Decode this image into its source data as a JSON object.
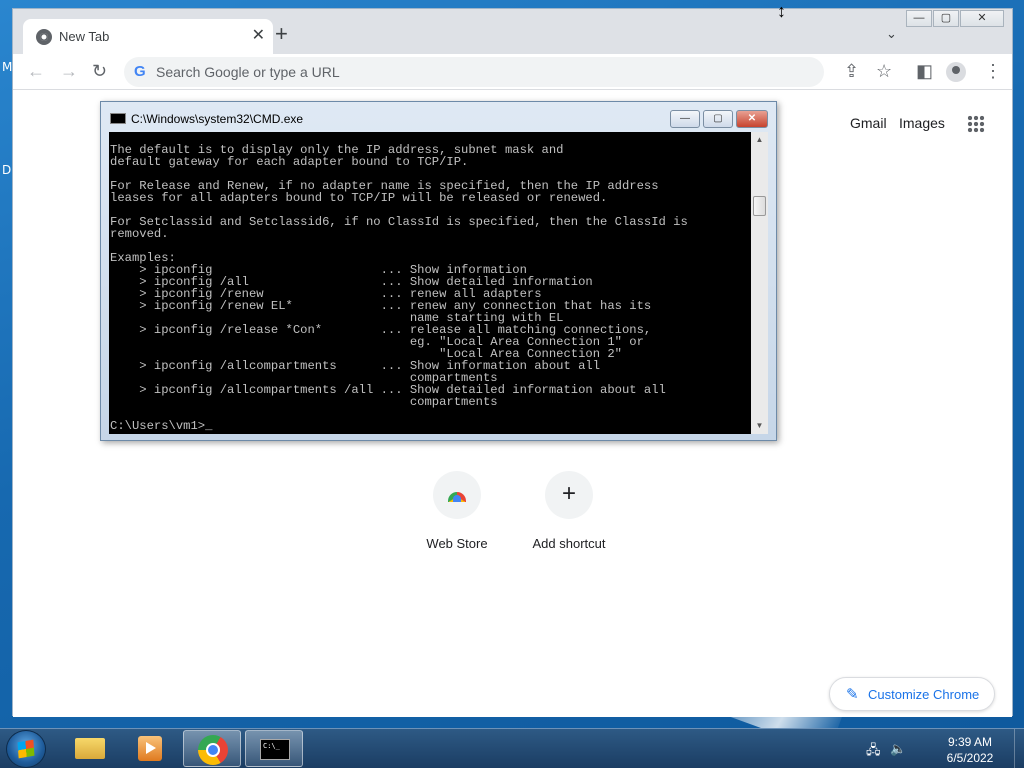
{
  "desktop": {
    "left_letters": [
      "M",
      "D"
    ]
  },
  "browser": {
    "tab": {
      "title": "New Tab",
      "close_icon": "✕"
    },
    "new_tab_icon": "+",
    "tab_dropdown_icon": "⌄",
    "window_controls": {
      "minimize": "—",
      "maximize": "▢",
      "close": "✕"
    },
    "toolbar": {
      "back_icon": "←",
      "forward_icon": "→",
      "reload_icon": "↻",
      "omnibox_placeholder": "Search Google or type a URL",
      "google_icon_letter": "G",
      "share_icon": "⇪",
      "star_icon": "☆",
      "sidepanel_icon": "◧",
      "menu_icon": "⋮"
    },
    "content": {
      "links": [
        "Gmail",
        "Images"
      ],
      "shortcuts": [
        {
          "label": "Web Store"
        },
        {
          "label": "Add shortcut",
          "icon": "+"
        }
      ],
      "customize_label": "Customize Chrome",
      "customize_icon": "✎"
    }
  },
  "cmd": {
    "title": "C:\\Windows\\system32\\CMD.exe",
    "buttons": {
      "minimize": "—",
      "maximize": "▢",
      "close": "✕"
    },
    "scroll_up": "▲",
    "scroll_down": "▼",
    "lines": [
      "The default is to display only the IP address, subnet mask and",
      "default gateway for each adapter bound to TCP/IP.",
      "",
      "For Release and Renew, if no adapter name is specified, then the IP address",
      "leases for all adapters bound to TCP/IP will be released or renewed.",
      "",
      "For Setclassid and Setclassid6, if no ClassId is specified, then the ClassId is",
      "removed.",
      "",
      "Examples:",
      "    > ipconfig                       ... Show information",
      "    > ipconfig /all                  ... Show detailed information",
      "    > ipconfig /renew                ... renew all adapters",
      "    > ipconfig /renew EL*            ... renew any connection that has its",
      "                                         name starting with EL",
      "    > ipconfig /release *Con*        ... release all matching connections,",
      "                                         eg. \"Local Area Connection 1\" or",
      "                                             \"Local Area Connection 2\"",
      "    > ipconfig /allcompartments      ... Show information about all",
      "                                         compartments",
      "    > ipconfig /allcompartments /all ... Show detailed information about all",
      "                                         compartments",
      "",
      "C:\\Users\\vm1>_"
    ]
  },
  "taskbar": {
    "apps": [
      "file-explorer",
      "media-player",
      "chrome",
      "cmd"
    ],
    "active_app": "chrome",
    "tray_icons": [
      "network-icon",
      "volume-icon"
    ],
    "tray_glyphs": {
      "network": "🖧",
      "volume": "🔈"
    },
    "time": "9:39 AM",
    "date": "6/5/2022"
  },
  "cursor_glyph": "↕",
  "colors": {
    "accent_blue": "#1a73e8",
    "tabstrip": "#dee1e6",
    "cmd_text": "#c0c0c0"
  }
}
